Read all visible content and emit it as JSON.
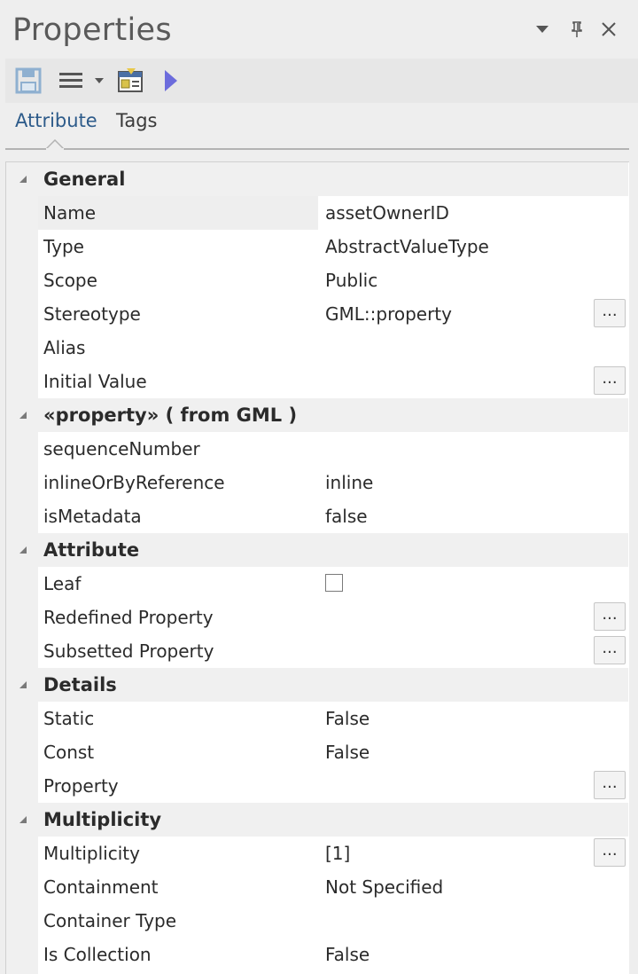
{
  "window": {
    "title": "Properties"
  },
  "toolbar": {
    "buttons": [
      {
        "icon": "save-icon"
      },
      {
        "icon": "menu-icon"
      },
      {
        "icon": "dropdown-arrow-icon"
      },
      {
        "icon": "properties-window-icon"
      },
      {
        "icon": "play-arrow-icon"
      }
    ]
  },
  "tabs": [
    {
      "label": "Attribute",
      "active": true
    },
    {
      "label": "Tags",
      "active": false
    }
  ],
  "sections": [
    {
      "title": "General",
      "rows": [
        {
          "name": "Name",
          "value": "assetOwnerID",
          "selected": true
        },
        {
          "name": "Type",
          "value": "AbstractValueType"
        },
        {
          "name": "Scope",
          "value": "Public"
        },
        {
          "name": "Stereotype",
          "value": "GML::property",
          "ellipsis": "..."
        },
        {
          "name": "Alias",
          "value": ""
        },
        {
          "name": "Initial Value",
          "value": "",
          "ellipsis": "..."
        }
      ]
    },
    {
      "title": "«property»  ( from GML )",
      "rows": [
        {
          "name": "sequenceNumber",
          "value": ""
        },
        {
          "name": "inlineOrByReference",
          "value": "inline"
        },
        {
          "name": "isMetadata",
          "value": "false"
        }
      ]
    },
    {
      "title": "Attribute",
      "rows": [
        {
          "name": "Leaf",
          "value": "",
          "checkbox": false
        },
        {
          "name": "Redefined Property",
          "value": "",
          "ellipsis": "..."
        },
        {
          "name": "Subsetted Property",
          "value": "",
          "ellipsis": "..."
        }
      ]
    },
    {
      "title": "Details",
      "rows": [
        {
          "name": "Static",
          "value": "False"
        },
        {
          "name": "Const",
          "value": "False"
        },
        {
          "name": "Property",
          "value": "",
          "ellipsis": "..."
        }
      ]
    },
    {
      "title": "Multiplicity",
      "rows": [
        {
          "name": "Multiplicity",
          "value": "[1]",
          "ellipsis": "..."
        },
        {
          "name": "Containment",
          "value": "Not Specified"
        },
        {
          "name": "Container Type",
          "value": ""
        },
        {
          "name": "Is Collection",
          "value": "False"
        }
      ]
    }
  ],
  "colors": {
    "accent_tab": "#2d5b8a",
    "play_icon": "#6c6cdc",
    "save_icon": "#8fb0d0"
  }
}
